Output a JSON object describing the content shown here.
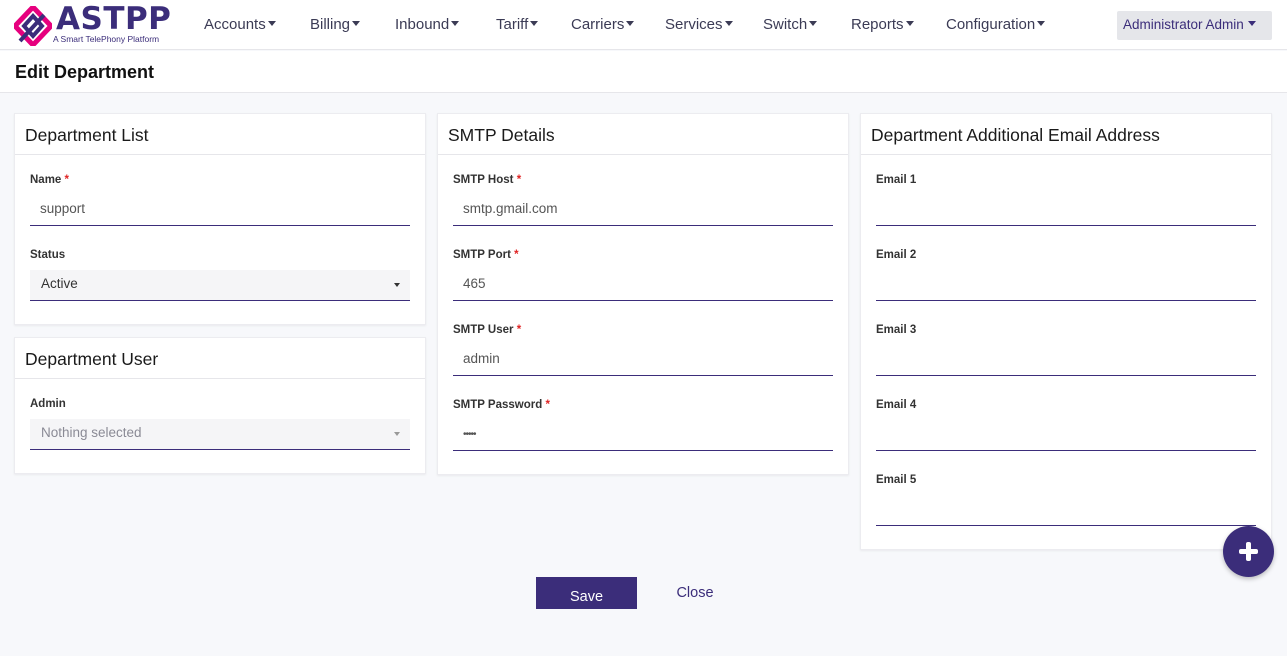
{
  "brand": {
    "name": "ASTPP",
    "tagline": "A Smart TelePhony Platform",
    "color": "#3b2d7a",
    "accent": "#e6007e"
  },
  "nav": {
    "items": [
      "Accounts",
      "Billing",
      "Inbound",
      "Tariff",
      "Carriers",
      "Services",
      "Switch",
      "Reports",
      "Configuration"
    ],
    "user": "Administrator Admin"
  },
  "page": {
    "title": "Edit Department"
  },
  "department_list": {
    "title": "Department List",
    "name_label": "Name",
    "name_value": "support",
    "status_label": "Status",
    "status_value": "Active"
  },
  "department_user": {
    "title": "Department User",
    "admin_label": "Admin",
    "admin_value": "Nothing selected"
  },
  "smtp": {
    "title": "SMTP Details",
    "host_label": "SMTP Host",
    "host_value": "smtp.gmail.com",
    "port_label": "SMTP Port",
    "port_value": "465",
    "user_label": "SMTP User",
    "user_value": "admin",
    "password_label": "SMTP Password",
    "password_value": "•••••"
  },
  "emails": {
    "title": "Department Additional Email Address",
    "labels": [
      "Email 1",
      "Email 2",
      "Email 3",
      "Email 4",
      "Email 5"
    ],
    "values": [
      "",
      "",
      "",
      "",
      ""
    ]
  },
  "required_mark": "*",
  "actions": {
    "save": "Save",
    "close": "Close",
    "fab_icon": "plus-icon"
  }
}
